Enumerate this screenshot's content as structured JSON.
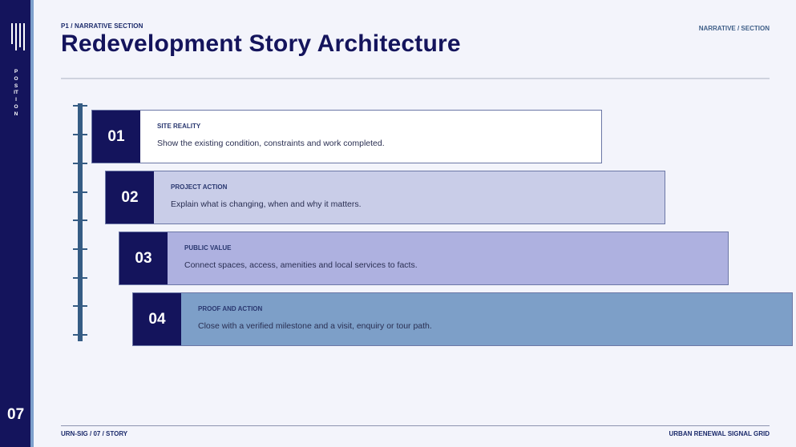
{
  "sidebar": {
    "vertical_label": "POSITION",
    "page_number": "07"
  },
  "header": {
    "eyebrow": "P1 / NARRATIVE SECTION",
    "title": "Redevelopment Story Architecture",
    "tag": "NARRATIVE / SECTION"
  },
  "steps": [
    {
      "number": "01",
      "label": "SITE REALITY",
      "description": "Show the existing condition, constraints and work completed.",
      "color": "#ffffff"
    },
    {
      "number": "02",
      "label": "PROJECT ACTION",
      "description": "Explain what is changing, when and why it matters.",
      "color": "#c9cde8"
    },
    {
      "number": "03",
      "label": "PUBLIC VALUE",
      "description": "Connect spaces, access, amenities and local services to facts.",
      "color": "#aeb1e0"
    },
    {
      "number": "04",
      "label": "PROOF AND ACTION",
      "description": "Close with a verified milestone and a visit, enquiry or tour path.",
      "color": "#7d9fc8"
    }
  ],
  "footer": {
    "left": "URN-SIG / 07 / STORY",
    "right": "URBAN RENEWAL SIGNAL GRID"
  },
  "colors": {
    "navy": "#14145c",
    "accent_blue": "#7da0cc",
    "timeline": "#355c84",
    "background": "#f3f4fb"
  }
}
